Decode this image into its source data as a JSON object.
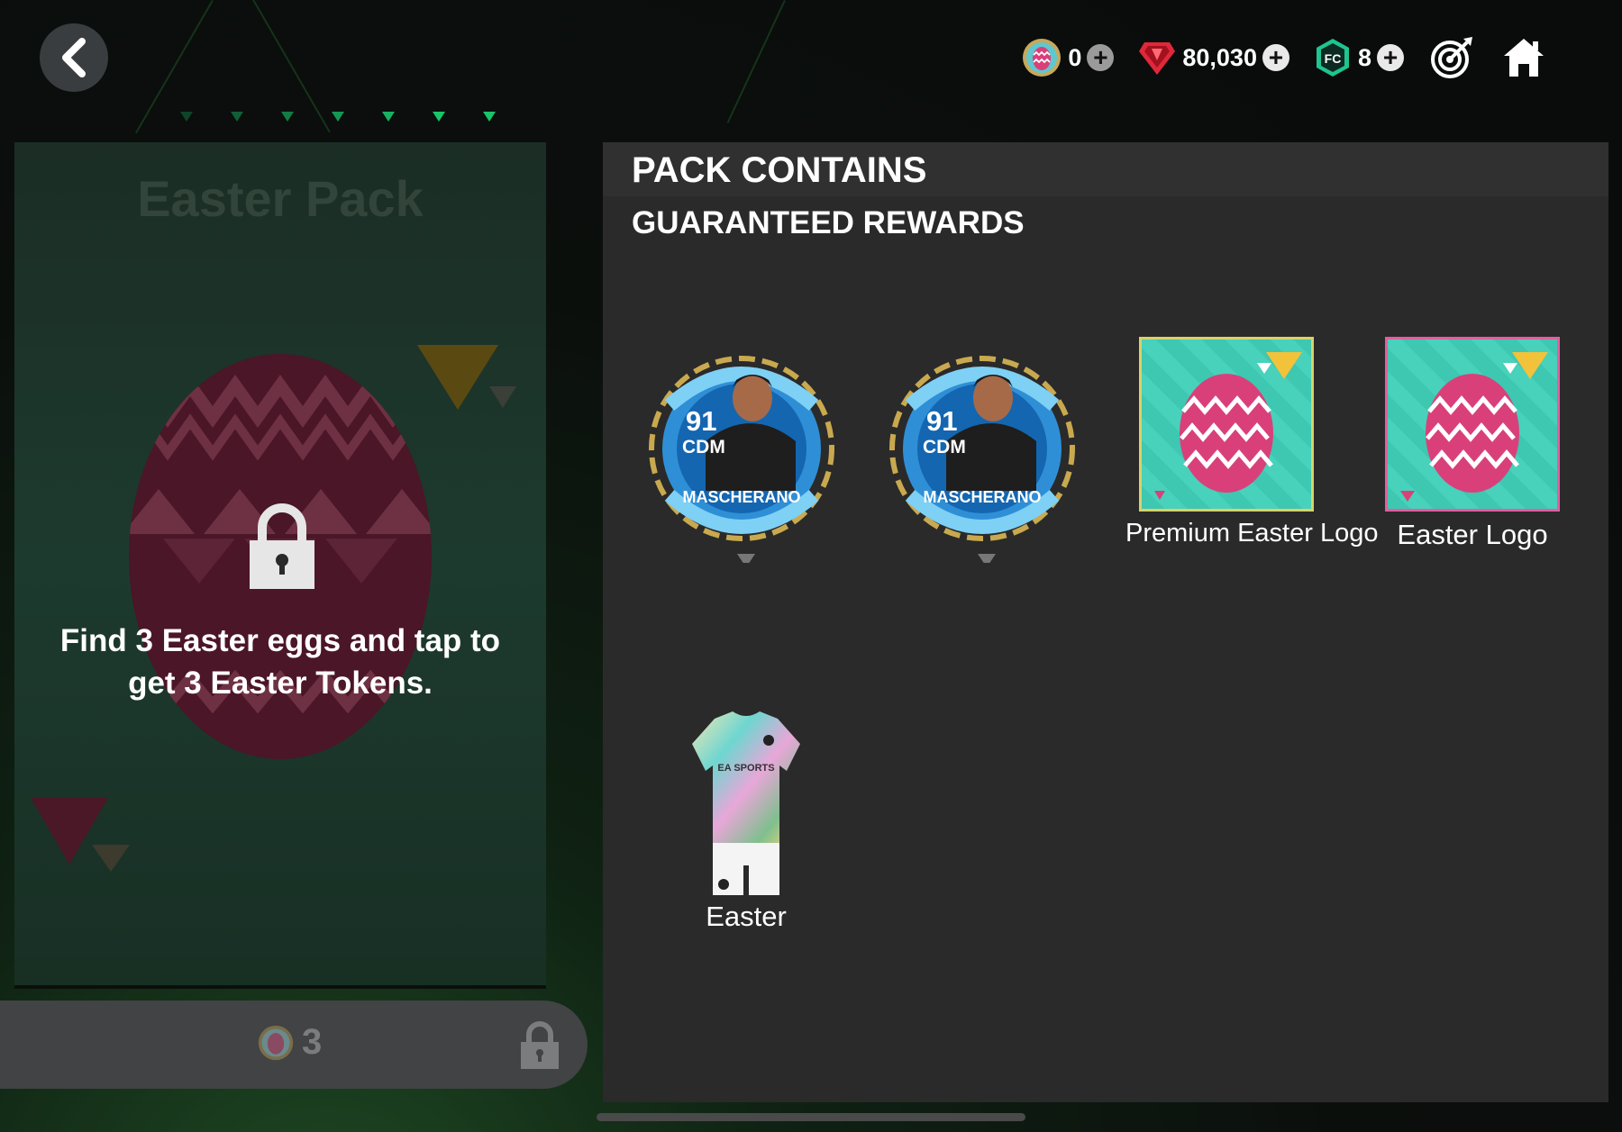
{
  "header": {
    "currencies": [
      {
        "icon": "easter-token-icon",
        "value": "0"
      },
      {
        "icon": "gem-icon",
        "value": "80,030"
      },
      {
        "icon": "fc-points-icon",
        "value": "8"
      }
    ]
  },
  "left_card": {
    "title": "Easter Pack",
    "message": "Find 3 Easter eggs and tap to get 3 Easter Tokens.",
    "cost": "3"
  },
  "pack_panel": {
    "title": "PACK CONTAINS",
    "subtitle": "GUARANTEED REWARDS",
    "rewards": [
      {
        "type": "player",
        "rating": "91",
        "position": "CDM",
        "name": "MASCHERANO",
        "label": ""
      },
      {
        "type": "player",
        "rating": "91",
        "position": "CDM",
        "name": "MASCHERANO",
        "label": ""
      },
      {
        "type": "logo",
        "label": "Premium Easter Logo"
      },
      {
        "type": "logo",
        "label": "Easter Logo"
      },
      {
        "type": "kit",
        "label": "Easter",
        "kit_brand": "EA SPORTS"
      }
    ]
  },
  "colors": {
    "accent_green": "#19c46a",
    "gem_red": "#e0283a",
    "egg_pink": "#d9407a",
    "panel": "#2a2a2a"
  }
}
